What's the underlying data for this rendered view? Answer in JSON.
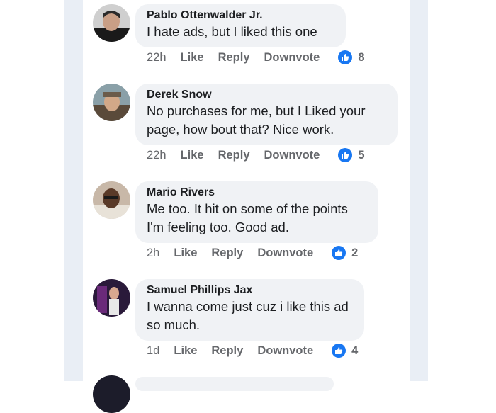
{
  "comments": [
    {
      "author": "Pablo Ottenwalder Jr.",
      "text": "I hate ads, but I liked this one",
      "time": "22h",
      "like_label": "Like",
      "reply_label": "Reply",
      "downvote_label": "Downvote",
      "likes": "8"
    },
    {
      "author": "Derek Snow",
      "text": "No purchases for me, but I Liked your page, how bout that? Nice work.",
      "time": "22h",
      "like_label": "Like",
      "reply_label": "Reply",
      "downvote_label": "Downvote",
      "likes": "5"
    },
    {
      "author": "Mario Rivers",
      "text": "Me too. It hit on some of the points I'm feeling too. Good ad.",
      "time": "2h",
      "like_label": "Like",
      "reply_label": "Reply",
      "downvote_label": "Downvote",
      "likes": "2"
    },
    {
      "author": "Samuel Phillips Jax",
      "text": "I wanna come just cuz i like this ad so much.",
      "time": "1d",
      "like_label": "Like",
      "reply_label": "Reply",
      "downvote_label": "Downvote",
      "likes": "4"
    }
  ],
  "colors": {
    "bubble": "#f0f2f5",
    "like_badge": "#1877f2",
    "side_panel": "#e9eef5"
  },
  "icons": {
    "like_badge": "thumbs-up-icon"
  }
}
